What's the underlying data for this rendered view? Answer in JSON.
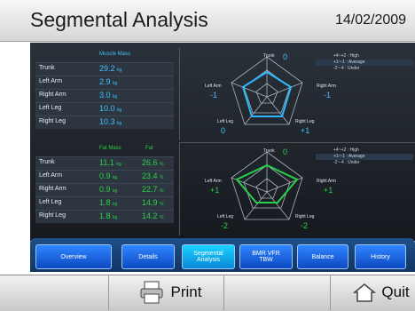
{
  "header": {
    "title": "Segmental Analysis",
    "date": "14/02/2009"
  },
  "muscle": {
    "header": "Muscle Mass",
    "unit": "kg",
    "rows": [
      {
        "label": "Trunk",
        "value": "29.2"
      },
      {
        "label": "Left Arm",
        "value": "2.9"
      },
      {
        "label": "Right Arm",
        "value": "3.0"
      },
      {
        "label": "Left Leg",
        "value": "10.0"
      },
      {
        "label": "Right Leg",
        "value": "10.3"
      }
    ],
    "radar": {
      "trunk_label": "Trunk",
      "trunk_value": "0",
      "left_arm_label": "Left Arm",
      "left_arm_value": "-1",
      "right_arm_label": "Right Arm",
      "right_arm_value": "-1",
      "left_leg_label": "Left Leg",
      "left_leg_value": "0",
      "right_leg_label": "Right Leg",
      "right_leg_value": "+1"
    },
    "line_color": "#2bb8ff"
  },
  "fat": {
    "header_mass": "Fat Mass",
    "header_pct": "Fat",
    "mass_unit": "kg",
    "pct_unit": "%",
    "rows": [
      {
        "label": "Trunk",
        "mass": "11.1",
        "pct": "26.6"
      },
      {
        "label": "Left Arm",
        "mass": "0.9",
        "pct": "23.4"
      },
      {
        "label": "Right Arm",
        "mass": "0.9",
        "pct": "22.7"
      },
      {
        "label": "Left Leg",
        "mass": "1.8",
        "pct": "14.9"
      },
      {
        "label": "Right Leg",
        "mass": "1.8",
        "pct": "14.2"
      }
    ],
    "radar": {
      "trunk_label": "Trunk",
      "trunk_value": "0",
      "left_arm_label": "Left Arm",
      "left_arm_value": "+1",
      "right_arm_label": "Right Arm",
      "right_arm_value": "+1",
      "left_leg_label": "Left Leg",
      "left_leg_value": "-2",
      "right_leg_label": "Right Leg",
      "right_leg_value": "-2"
    },
    "line_color": "#27d046"
  },
  "legend": {
    "high": "+4~+2 : High",
    "average": "+1~-1 : Average",
    "under": "-2~-4 : Under"
  },
  "nav": {
    "overview": "Overview",
    "details": "Details",
    "segmental": "Segmental Analysis",
    "bmr": "BMR VFR TBW",
    "balance": "Balance",
    "history": "History"
  },
  "bottom": {
    "print": "Print",
    "quit": "Quit"
  },
  "colors": {
    "muscle_text": "#3ec0ff",
    "fat_text": "#27d046",
    "header_text": "#1b1b1b",
    "nav_active": "#19d2ff"
  }
}
